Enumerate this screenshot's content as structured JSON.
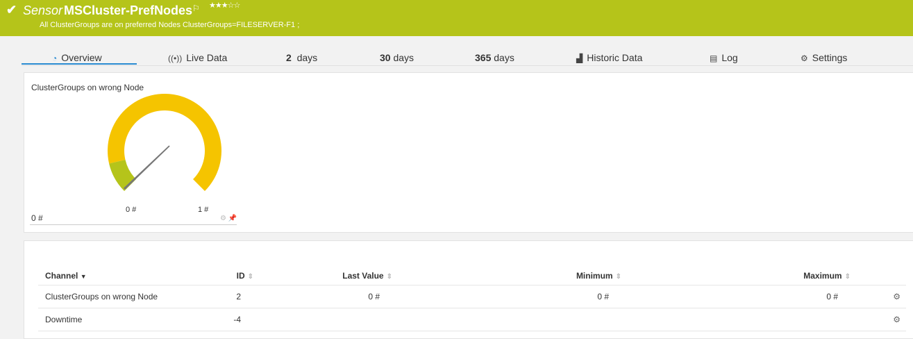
{
  "header": {
    "sensor_word": "Sensor",
    "sensor_name": "MSCluster-PrefNodes",
    "rating_stars": "★★★☆☆",
    "status_message": "All ClusterGroups are on preferred Nodes ClusterGroups=FILESERVER-F1 ;",
    "colors": {
      "status_bg": "#b5c41a"
    }
  },
  "tabs": [
    {
      "label": "Overview",
      "icon": "gauge-icon",
      "active": true
    },
    {
      "label": "Live Data",
      "icon": "live-data-icon"
    },
    {
      "num": "2",
      "label": "days"
    },
    {
      "num": "30",
      "label": "days"
    },
    {
      "num": "365",
      "label": "days"
    },
    {
      "label": "Historic Data",
      "icon": "area-chart-icon"
    },
    {
      "label": "Log",
      "icon": "log-icon"
    },
    {
      "label": "Settings",
      "icon": "gear-icon"
    }
  ],
  "gauge": {
    "title": "ClusterGroups on wrong Node",
    "min_label": "0 #",
    "max_label": "1 #",
    "value_label": "0 #",
    "value": 0,
    "colors": {
      "ok": "#b5c41a",
      "warning": "#f5c400",
      "needle": "#777777"
    }
  },
  "table": {
    "headers": {
      "channel": "Channel",
      "id": "ID",
      "last_value": "Last Value",
      "minimum": "Minimum",
      "maximum": "Maximum"
    },
    "rows": [
      {
        "channel": "ClusterGroups on wrong Node",
        "id": "2",
        "last_value": "0 #",
        "minimum": "0 #",
        "maximum": "0 #"
      },
      {
        "channel": "Downtime",
        "id": "-4",
        "last_value": "",
        "minimum": "",
        "maximum": ""
      }
    ]
  }
}
